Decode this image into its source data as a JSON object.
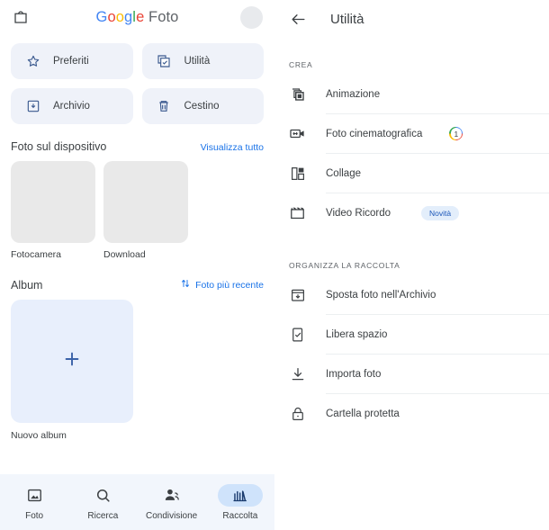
{
  "left": {
    "topbar": {
      "store_icon": "shopping-bag-icon",
      "brand": {
        "g1": "G",
        "o1": "o",
        "o2": "o",
        "g2": "g",
        "l1": "l",
        "e1": "e",
        "suffix": " Foto"
      }
    },
    "chips": [
      {
        "label": "Preferiti",
        "icon": "star-icon"
      },
      {
        "label": "Utilità",
        "icon": "utilities-icon"
      },
      {
        "label": "Archivio",
        "icon": "archive-icon"
      },
      {
        "label": "Cestino",
        "icon": "trash-icon"
      }
    ],
    "device_section": {
      "title": "Foto sul dispositivo",
      "action": "Visualizza tutto",
      "folders": [
        {
          "label": "Fotocamera"
        },
        {
          "label": "Download"
        }
      ]
    },
    "album_section": {
      "title": "Album",
      "action": "Foto più recente",
      "action_icon": "sort-icon",
      "new_album_label": "Nuovo album",
      "new_album_icon": "plus-icon"
    },
    "bottom_nav": [
      {
        "label": "Foto",
        "icon": "photo-icon",
        "active": false
      },
      {
        "label": "Ricerca",
        "icon": "search-icon",
        "active": false
      },
      {
        "label": "Condivisione",
        "icon": "people-icon",
        "active": false
      },
      {
        "label": "Raccolta",
        "icon": "library-icon",
        "active": true
      }
    ]
  },
  "right": {
    "topbar": {
      "back_icon": "arrow-back-icon",
      "title": "Utilità"
    },
    "groups": [
      {
        "header": "CREA",
        "items": [
          {
            "label": "Animazione",
            "icon": "animation-icon",
            "badge": null,
            "new": null
          },
          {
            "label": "Foto cinematografica",
            "icon": "cinematic-photo-icon",
            "badge": "1",
            "new": null
          },
          {
            "label": "Collage",
            "icon": "collage-icon",
            "badge": null,
            "new": null
          },
          {
            "label": "Video Ricordo",
            "icon": "movie-clapper-icon",
            "badge": null,
            "new": "Novità"
          }
        ]
      },
      {
        "header": "ORGANIZZA LA RACCOLTA",
        "items": [
          {
            "label": "Sposta foto nell'Archivio",
            "icon": "archive-down-icon",
            "badge": null,
            "new": null
          },
          {
            "label": "Libera spazio",
            "icon": "free-space-icon",
            "badge": null,
            "new": null
          },
          {
            "label": "Importa foto",
            "icon": "import-download-icon",
            "badge": null,
            "new": null
          },
          {
            "label": "Cartella protetta",
            "icon": "lock-icon",
            "badge": null,
            "new": null
          }
        ]
      }
    ]
  },
  "colors": {
    "google_blue": "#4285F4",
    "google_red": "#EA4335",
    "google_yellow": "#FBBC05",
    "google_green": "#34A853",
    "link_blue": "#1a73e8",
    "chip_bg": "#eff2f9",
    "active_pill": "#cfe3fb",
    "nav_bg": "#f2f6fc",
    "album_tile": "#e8effc",
    "thumb_bg": "#e9e9e9"
  }
}
